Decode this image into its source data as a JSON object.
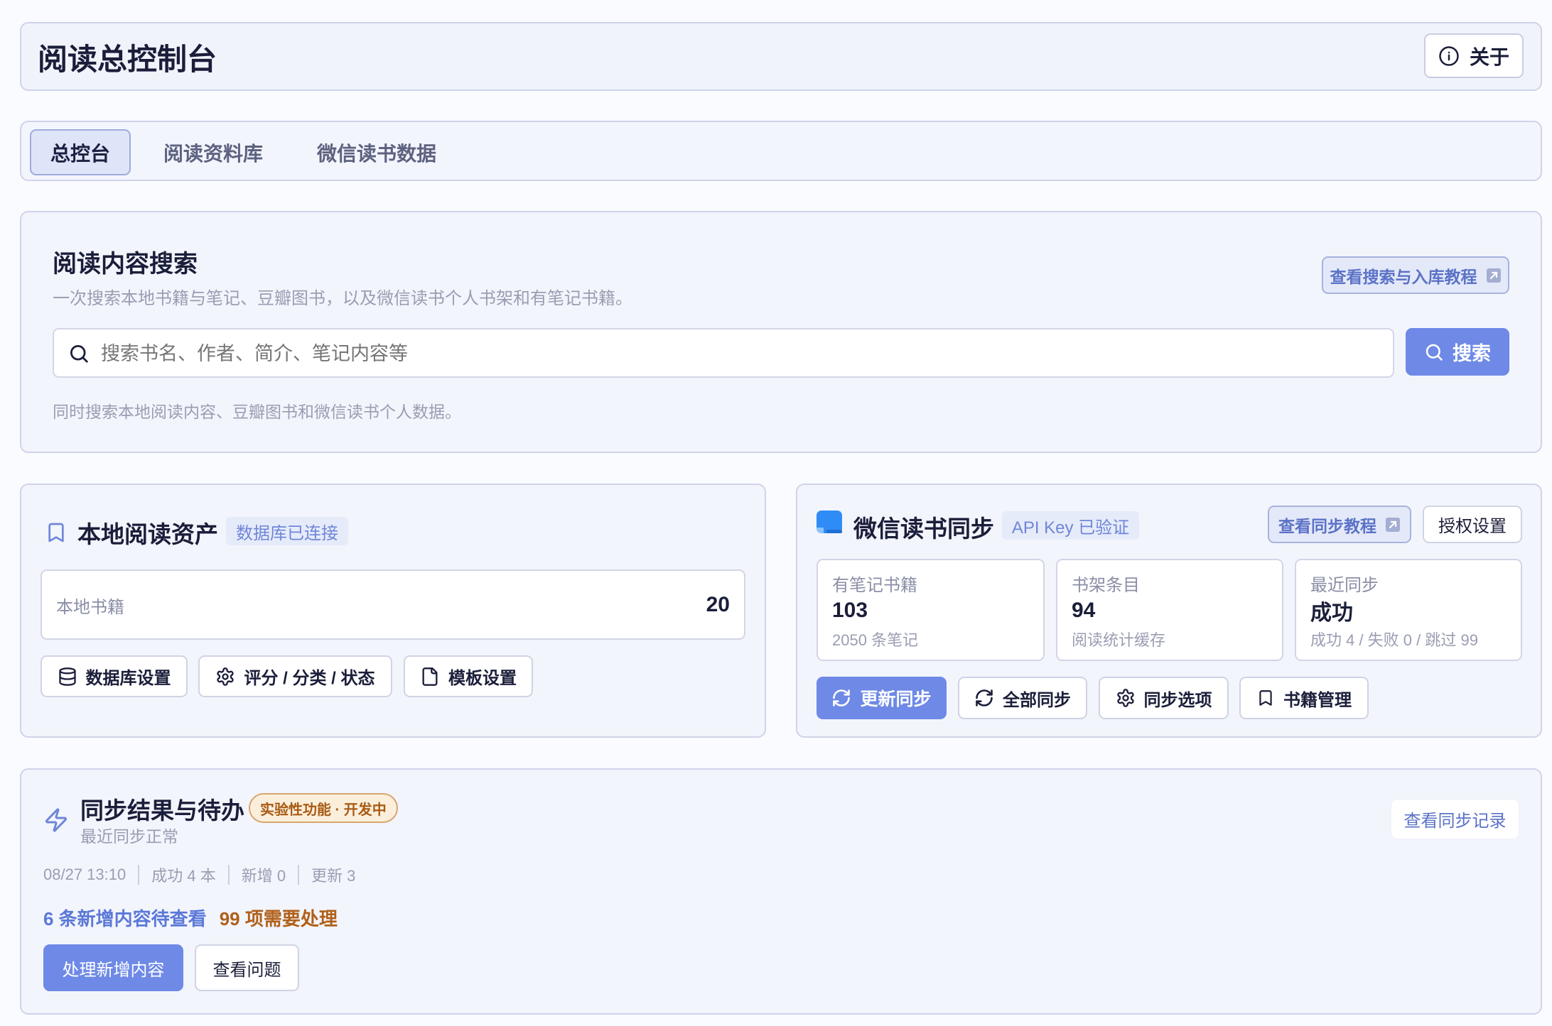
{
  "header": {
    "title": "阅读总控制台",
    "about_label": "关于"
  },
  "tabs": [
    {
      "label": "总控台",
      "active": true
    },
    {
      "label": "阅读资料库",
      "active": false
    },
    {
      "label": "微信读书数据",
      "active": false
    }
  ],
  "search": {
    "title": "阅读内容搜索",
    "subtitle": "一次搜索本地书籍与笔记、豆瓣图书，以及微信读书个人书架和有笔记书籍。",
    "tutorial_label": "查看搜索与入库教程",
    "placeholder": "搜索书名、作者、简介、笔记内容等",
    "value": "",
    "button_label": "搜索",
    "hint": "同时搜索本地阅读内容、豆瓣图书和微信读书个人数据。"
  },
  "local": {
    "title": "本地阅读资产",
    "badge": "数据库已连接",
    "stat_label": "本地书籍",
    "stat_value": "20",
    "buttons": [
      {
        "label": "数据库设置",
        "icon": "database-icon"
      },
      {
        "label": "评分 / 分类 / 状态",
        "icon": "gear-icon"
      },
      {
        "label": "模板设置",
        "icon": "file-icon"
      }
    ]
  },
  "wechat": {
    "title": "微信读书同步",
    "badge": "API Key 已验证",
    "tutorial_label": "查看同步教程",
    "auth_label": "授权设置",
    "stats": [
      {
        "label": "有笔记书籍",
        "value": "103",
        "sub": "2050 条笔记"
      },
      {
        "label": "书架条目",
        "value": "94",
        "sub": "阅读统计缓存"
      },
      {
        "label": "最近同步",
        "value": "成功",
        "sub": "成功 4 / 失败 0 / 跳过 99"
      }
    ],
    "actions": [
      {
        "label": "更新同步",
        "icon": "refresh-icon"
      },
      {
        "label": "全部同步",
        "icon": "refresh-icon"
      },
      {
        "label": "同步选项",
        "icon": "gear-icon"
      },
      {
        "label": "书籍管理",
        "icon": "bookmark-icon"
      }
    ]
  },
  "sync": {
    "title": "同步结果与待办",
    "badge": "实验性功能 · 开发中",
    "subtitle": "最近同步正常",
    "records_label": "查看同步记录",
    "meta": [
      "08/27 13:10",
      "成功 4 本",
      "新增 0",
      "更新 3"
    ],
    "new_items": "6 条新增内容待查看",
    "issues": "99 项需要处理",
    "process_label": "处理新增内容",
    "issues_label": "查看问题"
  },
  "colors": {
    "accent": "#6e89e6",
    "title": "#1b1e3a",
    "muted": "#969ab0",
    "card_bg": "#f3f5fc",
    "card_border": "#cfd3ea",
    "link": "#5b72c6",
    "warn": "#b0601a",
    "wechat_icon": "#2f8cf7"
  }
}
